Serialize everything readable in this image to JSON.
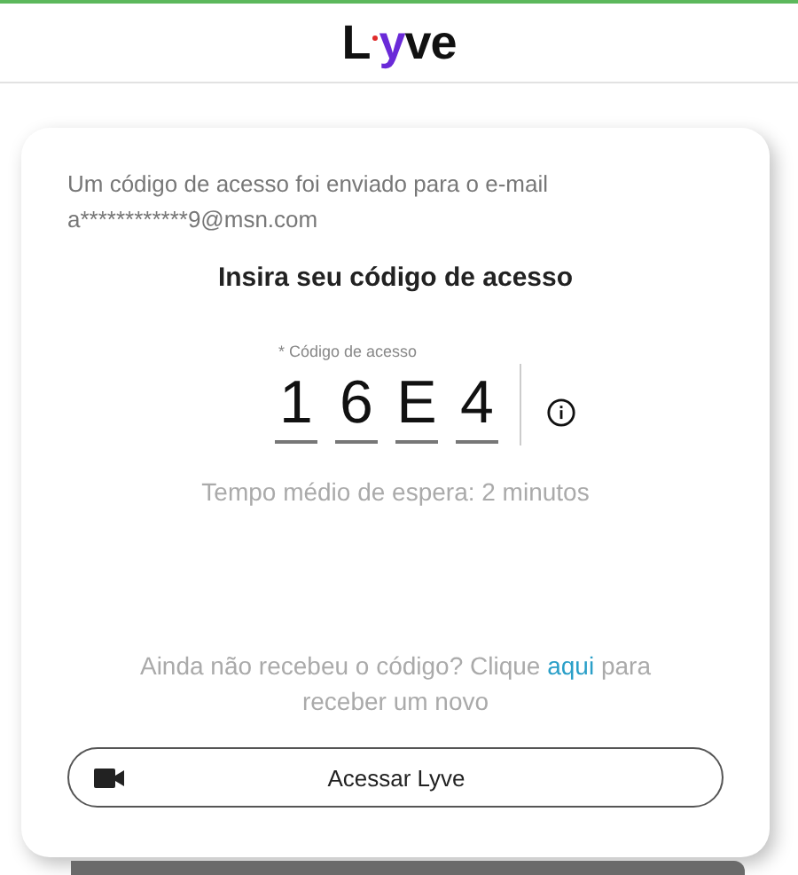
{
  "logo": {
    "first": "L",
    "accent": "y",
    "rest": "ve"
  },
  "message": "Um código de acesso foi enviado para o e-mail a************9@msn.com",
  "heading": "Insira seu código de acesso",
  "code_field": {
    "label": "* Código de acesso",
    "digits": [
      "1",
      "6",
      "E",
      "4"
    ]
  },
  "wait_text": "Tempo médio de espera: 2 minutos",
  "resend": {
    "before": "Ainda não recebeu o código? Clique ",
    "link": "aqui",
    "after": " para receber um novo"
  },
  "button": {
    "label": "Acessar Lyve"
  }
}
